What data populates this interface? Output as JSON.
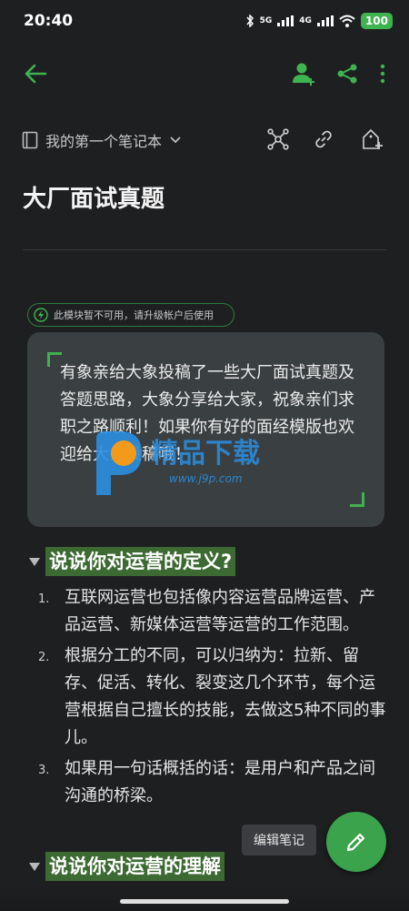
{
  "status": {
    "time": "20:40",
    "battery": "100",
    "net_left": "5G",
    "net_right": "4G"
  },
  "notebook": {
    "name": "我的第一个笔记本"
  },
  "note": {
    "title": "大厂面试真题",
    "upgrade_notice": "此模块暂不可用，请升级帐户后使用",
    "quote": "有象亲给大象投稿了一些大厂面试真题及答题思路，大象分享给大家，祝象亲们求职之路顺利！如果你有好的面经模版也欢迎给大象投稿哦！",
    "sections": [
      {
        "heading": "说说你对运营的定义?",
        "items": [
          {
            "num": "1.",
            "text": "互联网运营也包括像内容运营品牌运营、产品运营、新媒体运营等运营的工作范围。"
          },
          {
            "num": "2.",
            "text": "根据分工的不同，可以归纳为：拉新、留存、促活、转化、裂变这几个环节，每个运营根据自己擅长的技能，去做这5种不同的事儿。"
          },
          {
            "num": "3.",
            "text": "如果用一句话概括的话：是用户和产品之间沟通的桥梁。"
          }
        ]
      },
      {
        "heading": "说说你对运营的理解"
      }
    ]
  },
  "watermark": {
    "text": "精品下载",
    "url": "www.j9p.com"
  },
  "tooltip": "编辑笔记",
  "colors": {
    "accent": "#3fb34f",
    "background": "#1e1f21",
    "heading_highlight": "#3c6a32",
    "fab": "#3aa34b"
  },
  "icons": [
    "back-arrow-icon",
    "add-user-icon",
    "share-icon",
    "more-vert-icon",
    "notebook-icon",
    "chevron-down-icon",
    "mind-map-icon",
    "link-icon",
    "add-tag-icon",
    "lightning-icon",
    "edit-pencil-icon"
  ]
}
